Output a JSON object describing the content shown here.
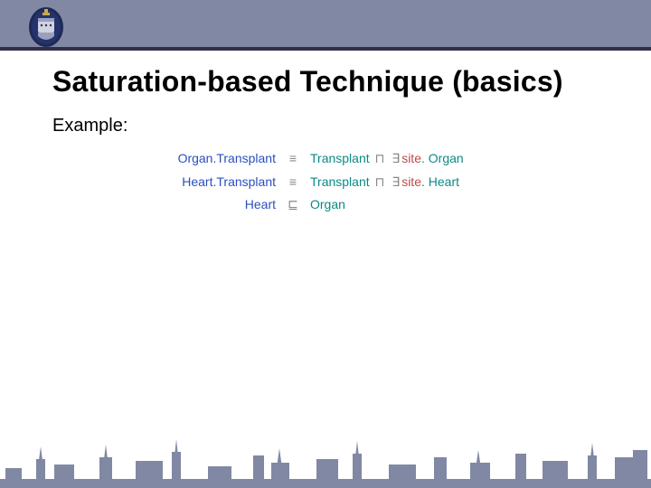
{
  "header": {
    "crest_label": "university-crest"
  },
  "title": "Saturation-based Technique (basics)",
  "example_label": "Example:",
  "colors": {
    "band": "#8188a4",
    "underline": "#2f2f46",
    "concept_lhs": "#2a4fbf",
    "concept_rhs1": "#0a8a85",
    "role": "#c04a4a",
    "symbol": "#888888"
  },
  "axioms": [
    {
      "lhs": "Organ.Transplant",
      "rel": "≡",
      "rhs_parts": [
        {
          "text": "Transplant",
          "cls": "c-trans"
        },
        {
          "text": " ⊓ ",
          "cls": "sym"
        },
        {
          "text": "∃",
          "cls": "sym"
        },
        {
          "text": "site",
          "cls": "c-role"
        },
        {
          "text": ". Organ",
          "cls": "c-trans"
        }
      ]
    },
    {
      "lhs": "Heart.Transplant",
      "rel": "≡",
      "rhs_parts": [
        {
          "text": "Transplant",
          "cls": "c-trans"
        },
        {
          "text": " ⊓ ",
          "cls": "sym"
        },
        {
          "text": "∃",
          "cls": "sym"
        },
        {
          "text": "site",
          "cls": "c-role"
        },
        {
          "text": ". Heart",
          "cls": "c-trans"
        }
      ]
    },
    {
      "lhs": "Heart",
      "rel": "⊑",
      "rhs_parts": [
        {
          "text": "Organ",
          "cls": "c-trans"
        }
      ]
    }
  ],
  "footer": {
    "skyline_label": "oxford-skyline"
  }
}
